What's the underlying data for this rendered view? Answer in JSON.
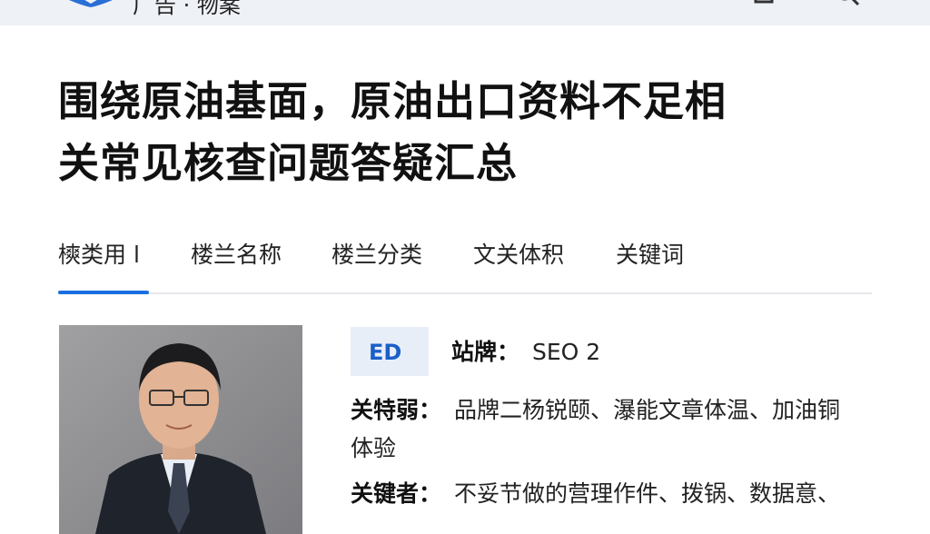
{
  "header": {
    "breadcrumb": "广告 · 物案",
    "logo_icon": "book-logo-icon",
    "icons": [
      "square-icon",
      "search-icon"
    ]
  },
  "article": {
    "title_line1": "围绕原油基面，原油出口资料不足相",
    "title_line2": "关常见核查问题答疑汇总"
  },
  "tabs": [
    {
      "label": "樉类用 l",
      "active": true
    },
    {
      "label": "楼兰名称",
      "active": false
    },
    {
      "label": "楼兰分类",
      "active": false
    },
    {
      "label": "文关体积",
      "active": false
    },
    {
      "label": "关键词",
      "active": false
    }
  ],
  "profile": {
    "badge_text": "ED",
    "brand_key": "站牌：",
    "brand_value": "SEO 2",
    "feature_key": "关特弱：",
    "feature_value": "品牌二杨锐颐、瀑能文章体温、加油铜",
    "feature_value_cont": "体验",
    "keyword_key": "关键者：",
    "keyword_value": "不妥节做的营理作件、拨锅、数据意、"
  },
  "colors": {
    "accent": "#1a6fe0",
    "badge_bg": "#e8eef8",
    "topbar_bg": "#eef1f6"
  }
}
